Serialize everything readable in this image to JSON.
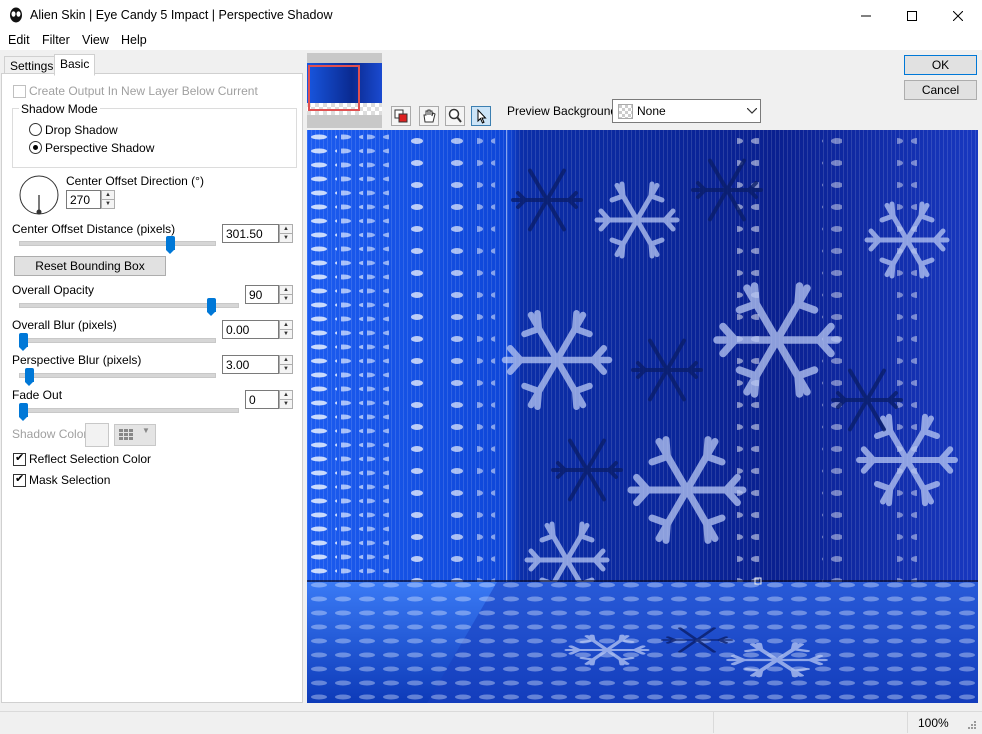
{
  "window": {
    "title": "Alien Skin | Eye Candy 5 Impact | Perspective Shadow"
  },
  "menu": [
    "Edit",
    "Filter",
    "View",
    "Help"
  ],
  "tabs": {
    "settings": "Settings",
    "basic": "Basic"
  },
  "basic": {
    "create_output_label": "Create Output In New Layer Below Current",
    "shadow_mode": {
      "legend": "Shadow Mode",
      "drop_shadow": "Drop Shadow",
      "perspective_shadow": "Perspective Shadow",
      "selected": "perspective_shadow"
    },
    "center_offset_direction": {
      "label": "Center Offset Direction (°)",
      "value": "270"
    },
    "center_offset_distance": {
      "label": "Center Offset Distance (pixels)",
      "value": "301.50",
      "slider_fraction": 0.79
    },
    "reset_bounding_box": "Reset Bounding Box",
    "overall_opacity": {
      "label": "Overall Opacity",
      "value": "90",
      "slider_fraction": 0.9
    },
    "overall_blur": {
      "label": "Overall Blur (pixels)",
      "value": "0.00",
      "slider_fraction": 0.0
    },
    "perspective_blur": {
      "label": "Perspective Blur (pixels)",
      "value": "3.00",
      "slider_fraction": 0.03
    },
    "fade_out": {
      "label": "Fade Out",
      "value": "0",
      "slider_fraction": 0.0
    },
    "shadow_color_label": "Shadow Color",
    "reflect_selection_color": "Reflect Selection Color",
    "mask_selection": "Mask Selection"
  },
  "buttons": {
    "ok": "OK",
    "cancel": "Cancel"
  },
  "preview_background": {
    "label": "Preview Background:",
    "value": "None"
  },
  "status": {
    "zoom": "100%"
  },
  "colors": {
    "accent": "#0078d7",
    "preview_blue": "#1a4fd6"
  }
}
